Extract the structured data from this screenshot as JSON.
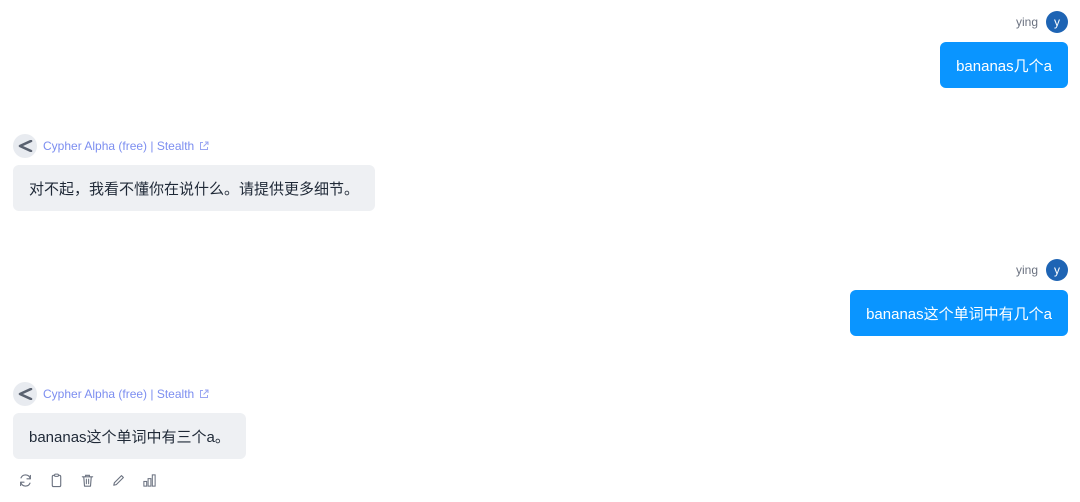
{
  "messages": [
    {
      "role": "user",
      "name": "ying",
      "avatar_letter": "y",
      "text": "bananas几个a"
    },
    {
      "role": "assistant",
      "model": "Cypher Alpha (free) | Stealth",
      "text": "对不起，我看不懂你在说什么。请提供更多细节。"
    },
    {
      "role": "user",
      "name": "ying",
      "avatar_letter": "y",
      "text": "bananas这个单词中有几个a"
    },
    {
      "role": "assistant",
      "model": "Cypher Alpha (free) | Stealth",
      "text": "bananas这个单词中有三个a。"
    }
  ],
  "actions": [
    {
      "icon": "regenerate-icon"
    },
    {
      "icon": "copy-icon"
    },
    {
      "icon": "delete-icon"
    },
    {
      "icon": "edit-icon"
    },
    {
      "icon": "stats-icon"
    }
  ],
  "colors": {
    "user_bubble": "#0a95ff",
    "user_avatar": "#1e64b4",
    "bot_bubble": "#eef0f3",
    "model_link": "#7c8ef0"
  }
}
